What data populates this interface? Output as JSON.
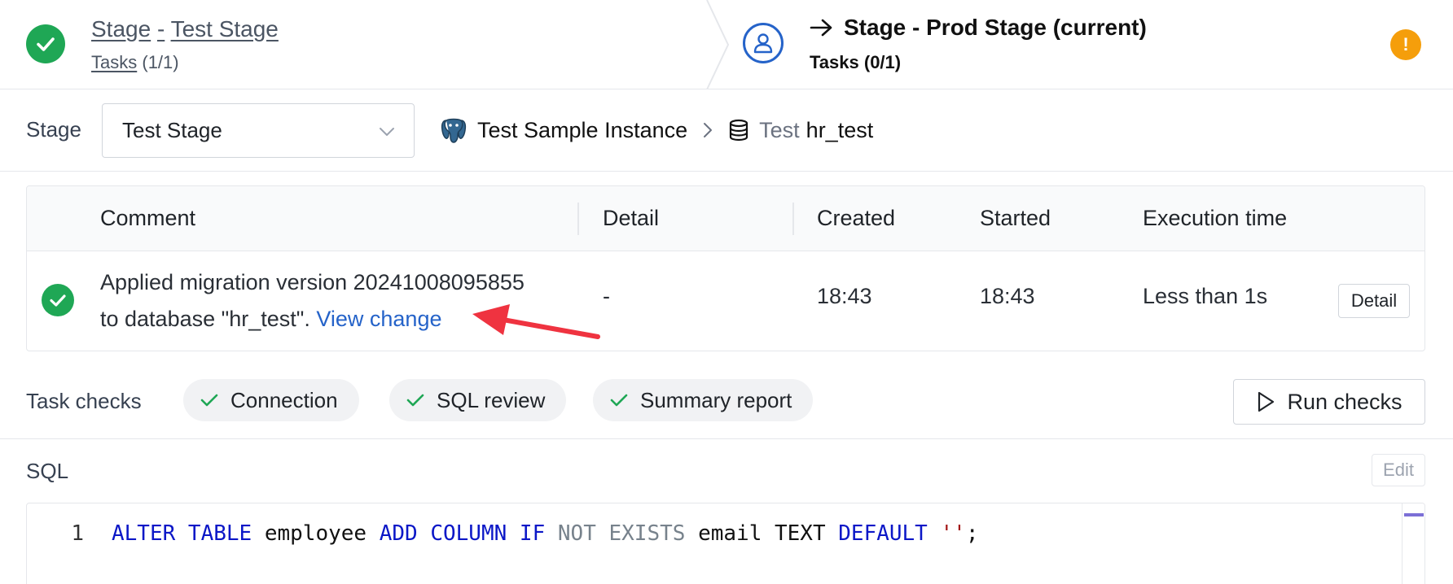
{
  "stages": {
    "completed": {
      "stage_link": "Stage",
      "separator": "-",
      "name_link": "Test Stage",
      "tasks_link": "Tasks",
      "tasks_count": "(1/1)"
    },
    "current": {
      "title": "Stage - Prod Stage (current)",
      "tasks_label": "Tasks",
      "tasks_count": "(0/1)",
      "warning_glyph": "!"
    }
  },
  "selector": {
    "label": "Stage",
    "selected_value": "Test Stage",
    "instance_icon": "postgresql-elephant-icon",
    "instance_name": "Test Sample Instance",
    "database_env": "Test",
    "database_name": "hr_test"
  },
  "task_table": {
    "columns": [
      "Comment",
      "Detail",
      "Created",
      "Started",
      "Execution time"
    ],
    "rows": [
      {
        "status": "done",
        "comment_line1": "Applied migration version 20241008095855",
        "comment_line2": "to database \"hr_test\".",
        "comment_link": "View change",
        "detail": "-",
        "created": "18:43",
        "started": "18:43",
        "execution_time": "Less than 1s",
        "action_label": "Detail"
      }
    ]
  },
  "task_checks": {
    "label": "Task checks",
    "checks": [
      {
        "label": "Connection",
        "status": "passed"
      },
      {
        "label": "SQL review",
        "status": "passed"
      },
      {
        "label": "Summary report",
        "status": "passed"
      }
    ],
    "run_label": "Run checks"
  },
  "sql": {
    "label": "SQL",
    "edit_label": "Edit",
    "line_number": "1",
    "tokens": {
      "t1": "ALTER TABLE",
      "t2": " employee ",
      "t3": "ADD COLUMN IF",
      "t4": " NOT EXISTS",
      "t5": " email TEXT ",
      "t6": "DEFAULT",
      "t7": " ''",
      "t8": ";"
    }
  },
  "colors": {
    "success": "#1fa755",
    "accent": "#2563c9",
    "warning": "#f59e0b",
    "annotation_arrow": "#ef3340"
  }
}
